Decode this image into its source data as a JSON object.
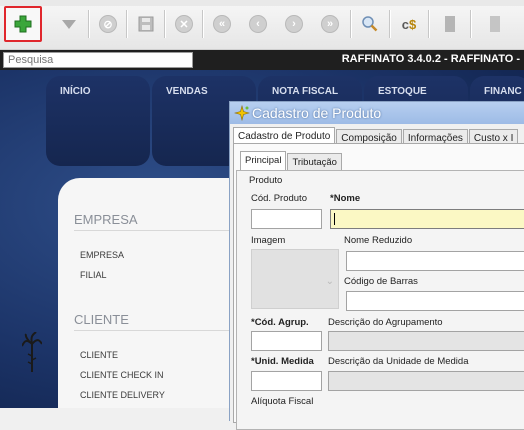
{
  "toolbar": {
    "buttons": [
      {
        "name": "add-icon",
        "glyph": "✚"
      },
      {
        "name": "dropdown-icon",
        "glyph": "▼"
      },
      {
        "name": "cancel-icon",
        "glyph": "⊘"
      },
      {
        "name": "save-icon",
        "glyph": "▦"
      },
      {
        "name": "delete-icon",
        "glyph": "⊗"
      },
      {
        "name": "first-record-icon",
        "glyph": "⏮"
      },
      {
        "name": "previous-record-icon",
        "glyph": "◀"
      },
      {
        "name": "next-record-icon",
        "glyph": "▶"
      },
      {
        "name": "last-record-icon",
        "glyph": "⏭"
      },
      {
        "name": "search-icon",
        "glyph": "🔍"
      },
      {
        "name": "cost-icon",
        "glyph": "C$"
      },
      {
        "name": "report-icon",
        "glyph": "▮"
      }
    ]
  },
  "search": {
    "placeholder": "Pesquisa"
  },
  "app": {
    "title": "RAFFINATO 3.4.0.2 - RAFFINATO -"
  },
  "menu_tabs": [
    "INÍCIO",
    "VENDAS",
    "NOTA FISCAL",
    "ESTOQUE",
    "FINANC"
  ],
  "side_panel": {
    "sections": [
      {
        "title": "EMPRESA",
        "items": [
          "EMPRESA",
          "FILIAL"
        ]
      },
      {
        "title": "CLIENTE",
        "items": [
          "CLIENTE",
          "CLIENTE CHECK IN",
          "CLIENTE DELIVERY"
        ]
      }
    ]
  },
  "dialog": {
    "title": "Cadastro de Produto",
    "tabs": [
      "Cadastro de Produto",
      "Composição",
      "Informações",
      "Custo x I"
    ],
    "subtabs": [
      "Principal",
      "Tributação"
    ],
    "group_label": "Produto",
    "fields": {
      "cod_produto": "Cód. Produto",
      "nome_marker": "*",
      "nome": "Nome",
      "imagem": "Imagem",
      "nome_reduzido": "Nome Reduzido",
      "codigo_barras": "Código de Barras",
      "cod_agrup": "*Cód. Agrup.",
      "desc_agrup": "Descrição do Agrupamento",
      "unid_medida": "*Unid. Medida",
      "desc_unid": "Descrição da Unidade de Medida",
      "aliquota": "Alíquota Fiscal"
    }
  }
}
